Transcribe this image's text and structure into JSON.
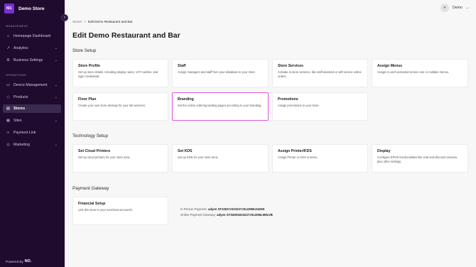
{
  "sidebar": {
    "logo_text": "NO.",
    "store_name": "Demo Store",
    "sections": [
      {
        "label": "MANAGEMENT"
      },
      {
        "label": "OPERATIONS"
      }
    ],
    "items": [
      {
        "label": "Homepage Dashboard",
        "icon": "home-icon"
      },
      {
        "label": "Analytics",
        "icon": "chart-icon"
      },
      {
        "label": "Business Settings",
        "icon": "gear-icon"
      },
      {
        "label": "Device Management",
        "icon": "device-icon"
      },
      {
        "label": "Products",
        "icon": "tag-icon"
      },
      {
        "label": "Stores",
        "icon": "store-icon"
      },
      {
        "label": "Sites",
        "icon": "grid-icon"
      },
      {
        "label": "Payment Link",
        "icon": "link-icon"
      },
      {
        "label": "Marketing",
        "icon": "target-icon"
      }
    ],
    "powered_by": "Powered By",
    "powered_logo": "NO."
  },
  "header": {
    "user_name": "Demo"
  },
  "breadcrumb": {
    "root": "Stores",
    "sep": ">",
    "current": "Edit Demo Restaurant and Bar"
  },
  "page_title": "Edit Demo Restaurant and Bar",
  "store_setup": {
    "title": "Store Setup",
    "cards": [
      {
        "title": "Store Profile",
        "desc": "Set up store details, including display name, VAT number, and login credentials."
      },
      {
        "title": "Staff",
        "desc": "Assign managers and staff from your database to your store."
      },
      {
        "title": "Store Services",
        "desc": "Activate in-store services, like staff-assisted or self-service online orders."
      },
      {
        "title": "Assign Menus",
        "desc": "Assign to each activated service one or multiple menus."
      },
      {
        "title": "Floor Plan",
        "desc": "Create your own store sitemap for your tab services."
      },
      {
        "title": "Branding",
        "desc": "Set the online ordering landing pages according to your branding."
      },
      {
        "title": "Promotions",
        "desc": "Assign promotions to your store."
      }
    ]
  },
  "tech_setup": {
    "title": "Technology Setup",
    "cards": [
      {
        "title": "Set Cloud Printers",
        "desc": "Set up cloud printers for your store area."
      },
      {
        "title": "Set KDS",
        "desc": "Set up KDS for your store area."
      },
      {
        "title": "Assign Printer/KDS",
        "desc": "Assign Printer or KDS to items."
      },
      {
        "title": "Display",
        "desc": "Configure EPOS functionalities like void and discount reasons, plus other settings."
      }
    ]
  },
  "payment": {
    "title": "Payment Gateway",
    "card": {
      "title": "Financial Setup",
      "desc": "Link this store to your merchant account/s."
    },
    "in_person_label": "In Person Payment:",
    "in_person_value": "adyen ST32DCV223227JSLD95KZ43HK",
    "online_label": "Online Payment Gateway:",
    "online_value": "adyen ST32D93223227JSLD95LM9LVB"
  },
  "colors": {
    "sidebar_bg": "#1e0b2e",
    "accent": "#7b2fd6",
    "highlight_border": "#e057d8"
  }
}
